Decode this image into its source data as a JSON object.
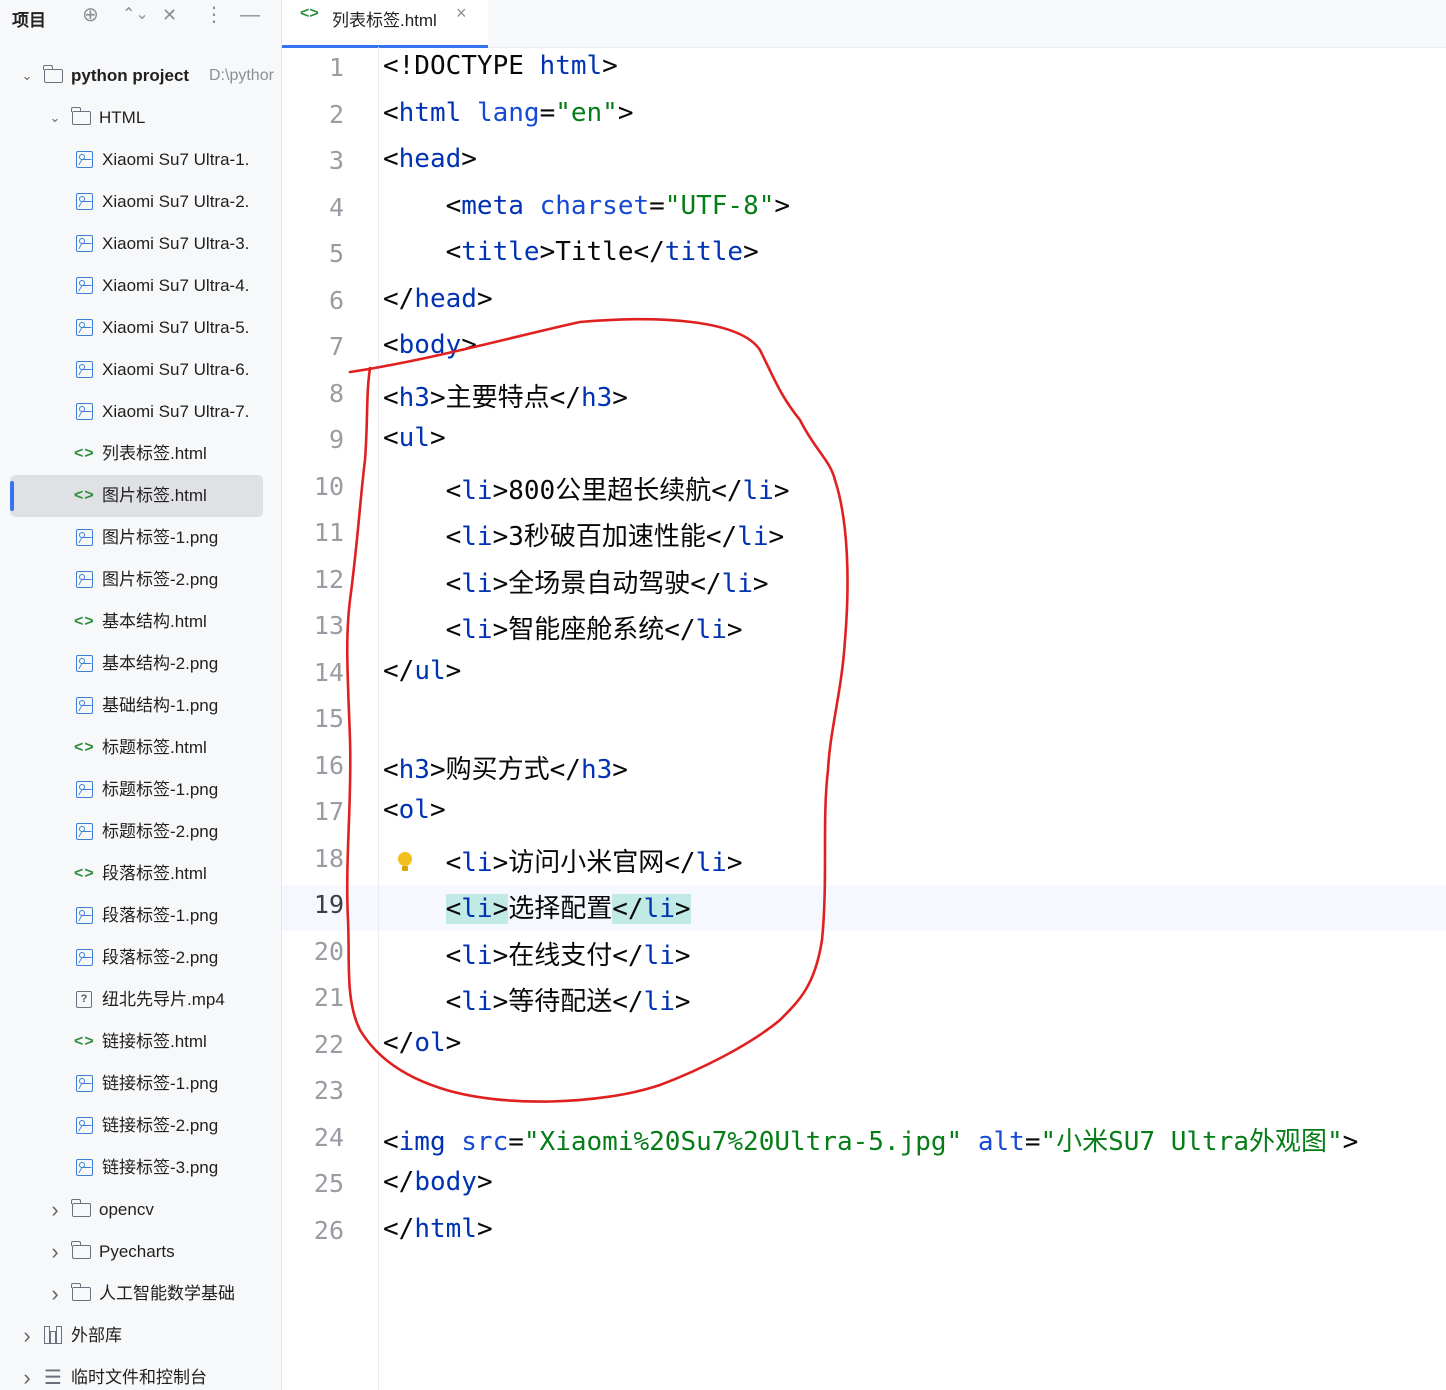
{
  "sidebar": {
    "title": "项目",
    "header_icons": [
      "crosshair-icon",
      "expand-icon",
      "collapse-icon",
      "more-icon",
      "minimize-icon"
    ],
    "items": [
      {
        "label": "python project",
        "hint": "D:\\pythor",
        "type": "folder",
        "expanded": true
      },
      {
        "label": "HTML",
        "type": "folder",
        "expanded": true
      },
      {
        "label": "Xiaomi Su7 Ultra-1.",
        "type": "image"
      },
      {
        "label": "Xiaomi Su7 Ultra-2.",
        "type": "image"
      },
      {
        "label": "Xiaomi Su7 Ultra-3.",
        "type": "image"
      },
      {
        "label": "Xiaomi Su7 Ultra-4.",
        "type": "image"
      },
      {
        "label": "Xiaomi Su7 Ultra-5.",
        "type": "image"
      },
      {
        "label": "Xiaomi Su7 Ultra-6.",
        "type": "image"
      },
      {
        "label": "Xiaomi Su7 Ultra-7.",
        "type": "image"
      },
      {
        "label": "列表标签.html",
        "type": "html"
      },
      {
        "label": "图片标签.html",
        "type": "html",
        "selected": true
      },
      {
        "label": "图片标签-1.png",
        "type": "image"
      },
      {
        "label": "图片标签-2.png",
        "type": "image"
      },
      {
        "label": "基本结构.html",
        "type": "html"
      },
      {
        "label": "基本结构-2.png",
        "type": "image"
      },
      {
        "label": "基础结构-1.png",
        "type": "image"
      },
      {
        "label": "标题标签.html",
        "type": "html"
      },
      {
        "label": "标题标签-1.png",
        "type": "image"
      },
      {
        "label": "标题标签-2.png",
        "type": "image"
      },
      {
        "label": "段落标签.html",
        "type": "html"
      },
      {
        "label": "段落标签-1.png",
        "type": "image"
      },
      {
        "label": "段落标签-2.png",
        "type": "image"
      },
      {
        "label": "纽北先导片.mp4",
        "type": "unknown"
      },
      {
        "label": "链接标签.html",
        "type": "html"
      },
      {
        "label": "链接标签-1.png",
        "type": "image"
      },
      {
        "label": "链接标签-2.png",
        "type": "image"
      },
      {
        "label": "链接标签-3.png",
        "type": "image"
      },
      {
        "label": "opencv",
        "type": "folder",
        "expanded": false
      },
      {
        "label": "Pyecharts",
        "type": "folder",
        "expanded": false
      },
      {
        "label": "人工智能数学基础",
        "type": "folder",
        "expanded": false
      },
      {
        "label": "外部库",
        "type": "library",
        "expanded": false
      },
      {
        "label": "临时文件和控制台",
        "type": "scratch",
        "expanded": false
      }
    ]
  },
  "editor": {
    "tab": {
      "label": "列表标签.html",
      "icon": "html-file-icon"
    },
    "current_line": 19,
    "lines": [
      "<!DOCTYPE html>",
      "<html lang=\"en\">",
      "<head>",
      "    <meta charset=\"UTF-8\">",
      "    <title>Title</title>",
      "</head>",
      "<body>",
      "<h3>主要特点</h3>",
      "<ul>",
      "    <li>800公里超长续航</li>",
      "    <li>3秒破百加速性能</li>",
      "    <li>全场景自动驾驶</li>",
      "    <li>智能座舱系统</li>",
      "</ul>",
      "",
      "<h3>购买方式</h3>",
      "<ol>",
      "    <li>访问小米官网</li>",
      "    <li>选择配置</li>",
      "    <li>在线支付</li>",
      "    <li>等待配送</li>",
      "</ol>",
      "",
      "<img src=\"Xiaomi%20Su7%20Ultra-5.jpg\" alt=\"小米SU7 Ultra外观图\">",
      "</body>",
      "</html>"
    ]
  },
  "colors": {
    "tag": "#0033b3",
    "attribute": "#174ad4",
    "string": "#067d17",
    "annotation": "#e02020",
    "selection_accent": "#3574f0",
    "tag_match_highlight": "#c1e9e6"
  }
}
